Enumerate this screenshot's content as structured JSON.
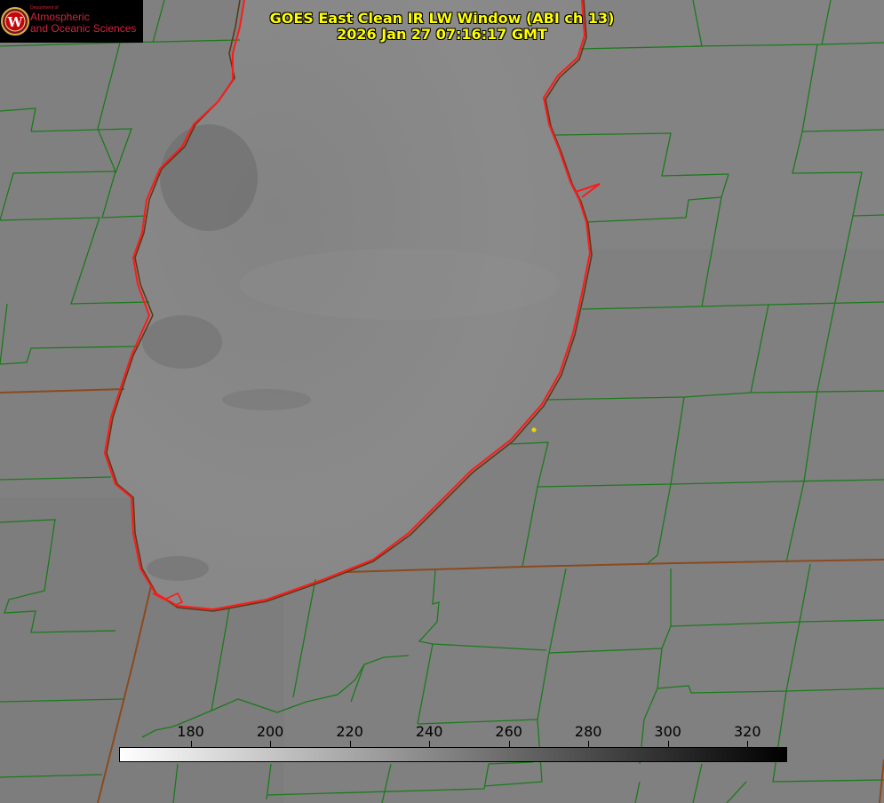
{
  "title": {
    "line1": "GOES East Clean IR LW Window (ABI ch 13)",
    "line2": "2026 Jan 27 07:16:17 GMT"
  },
  "logo": {
    "department": "Department of",
    "line1": "Atmospheric",
    "line2": "and Oceanic Sciences",
    "seal_letter": "W",
    "color": "#d4243a"
  },
  "colorbar": {
    "min": 162,
    "max": 330,
    "ticks": [
      "180",
      "200",
      "220",
      "240",
      "260",
      "280",
      "300",
      "320"
    ],
    "tick_values": [
      180,
      200,
      220,
      240,
      260,
      280,
      300,
      320
    ],
    "from_color": "#ffffff",
    "to_color": "#000000"
  },
  "colors": {
    "county_lines": "#1c7a1c",
    "state_lines": "#8b4a1f",
    "lake_outline": "#ff1a1a",
    "point_marker": "#e6d800",
    "title": "#ffff00"
  }
}
